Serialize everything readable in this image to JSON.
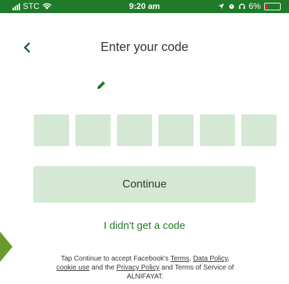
{
  "status_bar": {
    "carrier": "STC",
    "time": "9:20 am",
    "battery": "6%"
  },
  "header": {
    "title": "Enter your code"
  },
  "code_input": {
    "box_count": 6,
    "box_color": "#d5e8d3"
  },
  "actions": {
    "continue_label": "Continue",
    "no_code_label": "I didn't get a code"
  },
  "terms": {
    "t1": "Tap Continue to accept Facebook's ",
    "terms_link": "Terms",
    "t2": ", ",
    "data_policy_link": "Data Policy",
    "t3": ",",
    "cookie_link": "cookie use",
    "t4": " and the ",
    "privacy_link": "Privacy Policy",
    "t5": " and Terms of Service of ALNIFAYAT."
  },
  "colors": {
    "brand_green": "#1f7a2a",
    "light_green": "#d5e8d3"
  }
}
